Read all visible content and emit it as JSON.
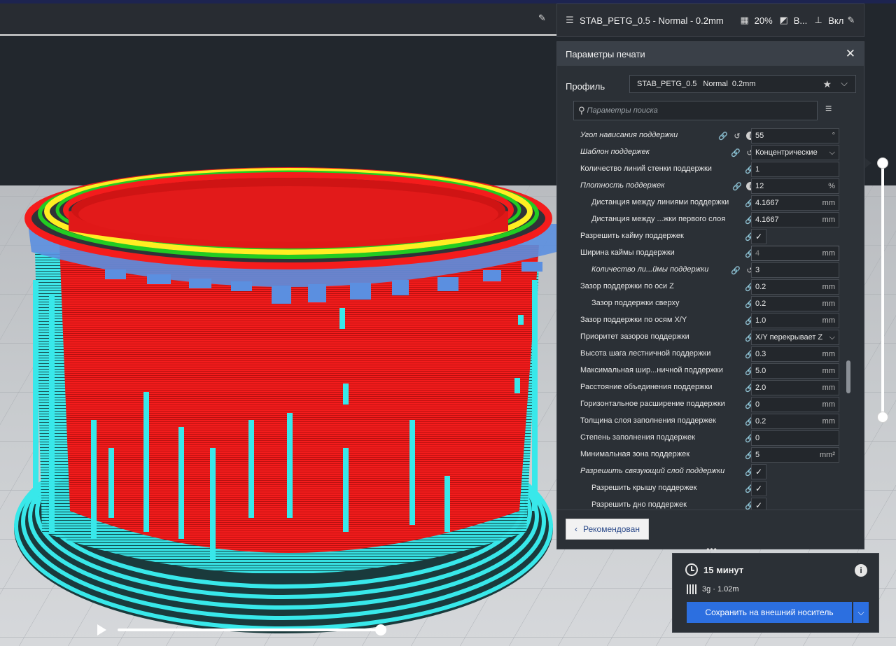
{
  "profile_bar": {
    "name": "STAB_PETG_0.5 - Normal - 0.2mm",
    "infill": "20%",
    "support": "В...",
    "adhesion": "Вкл"
  },
  "panel": {
    "title": "Параметры печати",
    "profile_label": "Профиль",
    "profile": {
      "name": "STAB_PETG_0.5",
      "quality": "Normal",
      "layer": "0.2mm"
    },
    "search_placeholder": "Параметры поиска",
    "settings": [
      {
        "label": "Угол нависания поддержки",
        "italic": true,
        "indent": 0,
        "icons": [
          "link-icon",
          "reset-icon",
          "info-icon"
        ],
        "value": "55",
        "unit": "°"
      },
      {
        "label": "Шаблон поддержек",
        "italic": true,
        "indent": 0,
        "icons": [
          "link-icon",
          "reset-icon"
        ],
        "value": "Концентрические",
        "select": true
      },
      {
        "label": "Количество линий стенки поддержки",
        "indent": 0,
        "icons": [
          "link-icon"
        ],
        "value": "1",
        "unit": ""
      },
      {
        "label": "Плотность поддержек",
        "italic": true,
        "indent": 0,
        "icons": [
          "link-icon",
          "info-icon"
        ],
        "value": "12",
        "unit": "%"
      },
      {
        "label": "Дистанция между линиями поддержки",
        "indent": 1,
        "icons": [
          "link-icon"
        ],
        "value": "4.1667",
        "unit": "mm"
      },
      {
        "label": "Дистанция между ...жки первого слоя",
        "indent": 1,
        "icons": [
          "link-icon"
        ],
        "value": "4.1667",
        "unit": "mm"
      },
      {
        "label": "Разрешить кайму поддержек",
        "indent": 0,
        "icons": [
          "link-icon"
        ],
        "check": true
      },
      {
        "label": "Ширина каймы поддержки",
        "indent": 0,
        "icons": [
          "link-icon"
        ],
        "value": "4",
        "unit": "mm",
        "disabled": true
      },
      {
        "label": "Количество ли...ймы поддержки",
        "italic": true,
        "indent": 1,
        "icons": [
          "link-icon",
          "reset-icon"
        ],
        "value": "3",
        "unit": ""
      },
      {
        "label": "Зазор поддержки по оси Z",
        "indent": 0,
        "icons": [
          "link-icon"
        ],
        "value": "0.2",
        "unit": "mm"
      },
      {
        "label": "Зазор поддержки сверху",
        "indent": 1,
        "icons": [
          "link-icon"
        ],
        "value": "0.2",
        "unit": "mm"
      },
      {
        "label": "Зазор поддержки по осям X/Y",
        "indent": 0,
        "icons": [
          "link-icon"
        ],
        "value": "1.0",
        "unit": "mm"
      },
      {
        "label": "Приоритет зазоров поддержки",
        "indent": 0,
        "icons": [
          "link-icon"
        ],
        "value": "X/Y перекрывает Z",
        "select": true
      },
      {
        "label": "Высота шага лестничной поддержки",
        "indent": 0,
        "icons": [
          "link-icon"
        ],
        "value": "0.3",
        "unit": "mm"
      },
      {
        "label": "Максимальная шир...ничной поддержки",
        "indent": 0,
        "icons": [
          "link-icon"
        ],
        "value": "5.0",
        "unit": "mm"
      },
      {
        "label": "Расстояние объединения поддержки",
        "indent": 0,
        "icons": [
          "link-icon"
        ],
        "value": "2.0",
        "unit": "mm"
      },
      {
        "label": "Горизонтальное расширение поддержки",
        "indent": 0,
        "icons": [
          "link-icon"
        ],
        "value": "0",
        "unit": "mm"
      },
      {
        "label": "Толщина слоя заполнения поддержек",
        "indent": 0,
        "icons": [
          "link-icon"
        ],
        "value": "0.2",
        "unit": "mm"
      },
      {
        "label": "Степень заполнения поддержек",
        "indent": 0,
        "icons": [
          "link-icon"
        ],
        "value": "0",
        "unit": ""
      },
      {
        "label": "Минимальная зона поддержек",
        "indent": 0,
        "icons": [
          "link-icon"
        ],
        "value": "5",
        "unit": "mm²"
      },
      {
        "label": "Разрешить связующий слой поддержки",
        "italic": true,
        "indent": 0,
        "icons": [
          "link-icon"
        ],
        "check": true
      },
      {
        "label": "Разрешить крышу поддержек",
        "indent": 1,
        "icons": [
          "link-icon"
        ],
        "check": true
      },
      {
        "label": "Разрешить дно поддержек",
        "indent": 1,
        "icons": [
          "link-icon"
        ],
        "check": true
      }
    ],
    "recommended_label": "Рекомендован"
  },
  "output": {
    "time": "15 минут",
    "material": "3g · 1.02m",
    "save_label": "Сохранить на внешний носитель"
  },
  "colors": {
    "model_wall": "#ff1a1a",
    "support": "#34e6e6",
    "support_interface": "#5b8fe0",
    "inner_wall": "#ffee22",
    "outer_wall_green": "#22cc22",
    "accent": "#2c6fe0"
  }
}
